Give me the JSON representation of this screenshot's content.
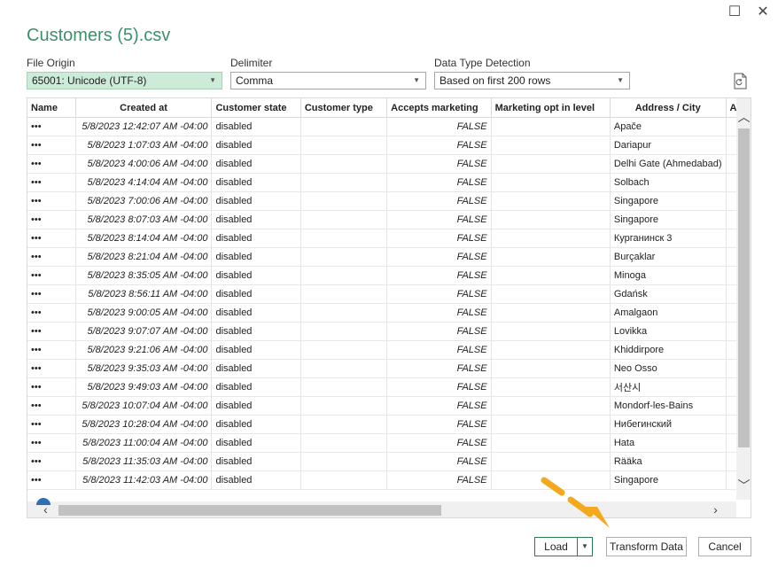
{
  "window": {
    "title": "Customers (5).csv"
  },
  "file_origin": {
    "label": "File Origin",
    "value": "65001: Unicode (UTF-8)"
  },
  "delimiter": {
    "label": "Delimiter",
    "value": "Comma"
  },
  "detection": {
    "label": "Data Type Detection",
    "value": "Based on first 200 rows"
  },
  "table": {
    "headers": [
      "Name",
      "Created at",
      "Customer state",
      "Customer type",
      "Accepts marketing",
      "Marketing opt in level",
      "Address / City",
      "A"
    ],
    "rows": [
      [
        "•••",
        "5/8/2023 12:42:07 AM -04:00",
        "disabled",
        "",
        "FALSE",
        "",
        "Apače"
      ],
      [
        "•••",
        "5/8/2023 1:07:03 AM -04:00",
        "disabled",
        "",
        "FALSE",
        "",
        "Dariapur"
      ],
      [
        "•••",
        "5/8/2023 4:00:06 AM -04:00",
        "disabled",
        "",
        "FALSE",
        "",
        "Delhi Gate (Ahmedabad)"
      ],
      [
        "•••",
        "5/8/2023 4:14:04 AM -04:00",
        "disabled",
        "",
        "FALSE",
        "",
        "Solbach"
      ],
      [
        "•••",
        "5/8/2023 7:00:06 AM -04:00",
        "disabled",
        "",
        "FALSE",
        "",
        "Singapore"
      ],
      [
        "•••",
        "5/8/2023 8:07:03 AM -04:00",
        "disabled",
        "",
        "FALSE",
        "",
        "Singapore"
      ],
      [
        "•••",
        "5/8/2023 8:14:04 AM -04:00",
        "disabled",
        "",
        "FALSE",
        "",
        "Курганинск 3"
      ],
      [
        "•••",
        "5/8/2023 8:21:04 AM -04:00",
        "disabled",
        "",
        "FALSE",
        "",
        "Burçaklar"
      ],
      [
        "•••",
        "5/8/2023 8:35:05 AM -04:00",
        "disabled",
        "",
        "FALSE",
        "",
        "Minoga"
      ],
      [
        "•••",
        "5/8/2023 8:56:11 AM -04:00",
        "disabled",
        "",
        "FALSE",
        "",
        "Gdańsk"
      ],
      [
        "•••",
        "5/8/2023 9:00:05 AM -04:00",
        "disabled",
        "",
        "FALSE",
        "",
        "Amalgaon"
      ],
      [
        "•••",
        "5/8/2023 9:07:07 AM -04:00",
        "disabled",
        "",
        "FALSE",
        "",
        "Lovikka"
      ],
      [
        "•••",
        "5/8/2023 9:21:06 AM -04:00",
        "disabled",
        "",
        "FALSE",
        "",
        "Khiddirpore"
      ],
      [
        "•••",
        "5/8/2023 9:35:03 AM -04:00",
        "disabled",
        "",
        "FALSE",
        "",
        "Neo Osso"
      ],
      [
        "•••",
        "5/8/2023 9:49:03 AM -04:00",
        "disabled",
        "",
        "FALSE",
        "",
        "서산시"
      ],
      [
        "•••",
        "5/8/2023 10:07:04 AM -04:00",
        "disabled",
        "",
        "FALSE",
        "",
        "Mondorf-les-Bains"
      ],
      [
        "•••",
        "5/8/2023 10:28:04 AM -04:00",
        "disabled",
        "",
        "FALSE",
        "",
        "Нибегинский"
      ],
      [
        "•••",
        "5/8/2023 11:00:04 AM -04:00",
        "disabled",
        "",
        "FALSE",
        "",
        "Hata"
      ],
      [
        "•••",
        "5/8/2023 11:35:03 AM -04:00",
        "disabled",
        "",
        "FALSE",
        "",
        "Rääka"
      ],
      [
        "•••",
        "5/8/2023 11:42:03 AM -04:00",
        "disabled",
        "",
        "FALSE",
        "",
        "Singapore"
      ]
    ]
  },
  "buttons": {
    "load": "Load",
    "transform": "Transform Data",
    "cancel": "Cancel"
  },
  "colors": {
    "title": "#3f8f6a",
    "selected_combo": "#cdebd9",
    "load_border": "#2e7d4f",
    "pointer_arrow": "#f4a81d"
  },
  "icons": {
    "minimize": "maximize-icon",
    "close": "close-icon",
    "refresh": "refresh-file-icon",
    "pointer": "pointer-arrow-icon"
  }
}
